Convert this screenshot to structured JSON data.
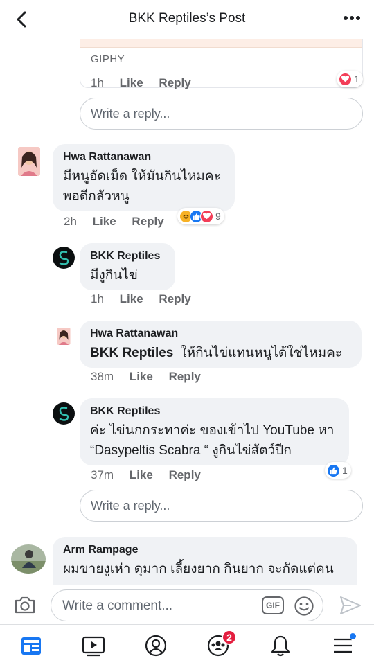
{
  "header": {
    "title": "BKK Reptiles’s Post"
  },
  "giphy": {
    "label": "GIPHY",
    "time": "1h",
    "like": "Like",
    "reply": "Reply",
    "reaction_count": "1"
  },
  "reply_box_1": {
    "placeholder": "Write a reply..."
  },
  "comments": [
    {
      "author": "Hwa Rattanawan",
      "lines": [
        "มีหนูอัดเม็ด ให้มันกินไหมคะ",
        "พอดีกลัวหนู"
      ],
      "time": "2h",
      "like": "Like",
      "reply": "Reply",
      "reactions": [
        "haha",
        "like",
        "love"
      ],
      "reaction_count": "9"
    },
    {
      "author": "BKK Reptiles",
      "lines": [
        "มีงูกินไข่"
      ],
      "time": "1h",
      "like": "Like",
      "reply": "Reply"
    },
    {
      "author": "Hwa Rattanawan",
      "mention": "BKK Reptiles",
      "lines": [
        "ให้กินไข่แทนหนูได้ใช่ไหมคะ"
      ],
      "time": "38m",
      "like": "Like",
      "reply": "Reply"
    },
    {
      "author": "BKK Reptiles",
      "lines": [
        "ค่ะ ไข่นกกระทาค่ะ ของเข้าไป YouTube หา",
        "“Dasypeltis Scabra “ งูกินไข่สัตว์ปีก"
      ],
      "time": "37m",
      "like": "Like",
      "reply": "Reply",
      "reactions": [
        "like"
      ],
      "reaction_count": "1"
    }
  ],
  "reply_box_2": {
    "placeholder": "Write a reply..."
  },
  "last_comment": {
    "author": "Arm Rampage",
    "lines": [
      "ผมขายงูเห่า ดุมาก เลี้ยงยาก กินยาก จะกัดแต่คน"
    ]
  },
  "composer": {
    "placeholder": "Write a comment...",
    "gif_label": "GIF"
  },
  "tabbar": {
    "groups_badge": "2"
  },
  "colors": {
    "like_blue": "#1877f2",
    "love_red": "#f33e58",
    "haha_yellow": "#f7b125",
    "badge_red": "#e41e3f"
  }
}
